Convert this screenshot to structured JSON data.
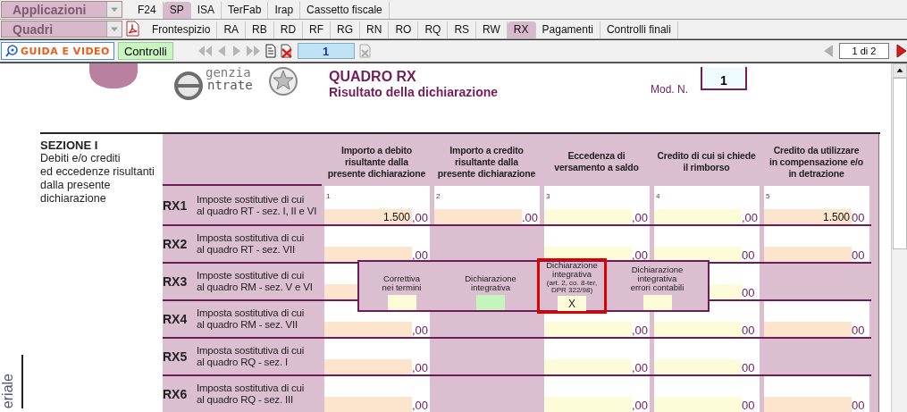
{
  "app_bar": {
    "dropdown": "Applicazioni",
    "tabs": [
      {
        "label": "F24",
        "selected": false
      },
      {
        "label": "SP",
        "selected": true
      },
      {
        "label": "ISA",
        "selected": false
      },
      {
        "label": "TerFab",
        "selected": false
      },
      {
        "label": "Irap",
        "selected": false
      },
      {
        "label": "Cassetto fiscale",
        "selected": false
      }
    ]
  },
  "quadri_bar": {
    "dropdown": "Quadri",
    "tabs": [
      {
        "label": "Frontespizio",
        "selected": false
      },
      {
        "label": "RA",
        "selected": false
      },
      {
        "label": "RB",
        "selected": false
      },
      {
        "label": "RD",
        "selected": false
      },
      {
        "label": "RF",
        "selected": false
      },
      {
        "label": "RG",
        "selected": false
      },
      {
        "label": "RN",
        "selected": false
      },
      {
        "label": "RO",
        "selected": false
      },
      {
        "label": "RQ",
        "selected": false
      },
      {
        "label": "RS",
        "selected": false
      },
      {
        "label": "RW",
        "selected": false
      },
      {
        "label": "RX",
        "selected": true
      },
      {
        "label": "Pagamenti",
        "selected": false
      },
      {
        "label": "Controlli finali",
        "selected": false
      }
    ]
  },
  "toolbar": {
    "guide_button": "GUIDA E VIDEO",
    "controls_button": "Controlli",
    "page_field": "1",
    "page_count": "1 di 2"
  },
  "header": {
    "logo_line_1": "genzia",
    "logo_line_2": "ntrate",
    "title": "QUADRO RX",
    "subtitle": "Risultato della dichiarazione",
    "model_label": "Mod. N.",
    "model_number": "1"
  },
  "section": {
    "title": "SEZIONE I",
    "description": "Debiti e/o crediti\ned eccedenze risultanti\ndalla presente\ndichiarazione",
    "columns": [
      "Importo a debito\nrisultante dalla\npresente dichiarazione",
      "Importo a credito\nrisultante dalla\npresente dichiarazione",
      "Eccedenza di\nversamento a saldo",
      "Credito di cui si chiede\nil rimborso",
      "Credito da utilizzare\nin compensazione e/o\nin detrazione"
    ],
    "rows": [
      {
        "code": "RX1",
        "description": "Imposte  sostitutive di cui\nal quadro RT - sez. I, II e VI",
        "cells": [
          {
            "number": "1",
            "value": "1.500",
            "suffix": ",00",
            "color": "#fde4cc"
          },
          {
            "number": "2",
            "suffix": ".00",
            "color": "#fde4cc"
          },
          {
            "number": "3",
            "suffix": ",00",
            "color": "#fdfcd8"
          },
          {
            "number": "4",
            "suffix": ",00",
            "color": "#fdfcd8"
          },
          {
            "number": "5",
            "value": "1.500",
            "suffix": "00",
            "color": "#fde4cc"
          }
        ]
      },
      {
        "code": "RX2",
        "description": "Imposta sostitutiva di cui\nal quadro RT - sez. VII",
        "cells": [
          {
            "suffix": ",00",
            "color": "#fde4cc"
          },
          null,
          {
            "suffix": ",00",
            "color": "#fdfcd8"
          },
          {
            "suffix": "00",
            "color": "#fdfcd8"
          },
          {
            "suffix": "00",
            "color": "#fde4cc"
          }
        ]
      },
      {
        "code": "RX3",
        "description": "Imposte sostitutive di cui\nal quadro RM - sez. V e VI",
        "cells": [
          {
            "color": "#fde4cc"
          },
          null,
          null,
          {
            "suffix": "00",
            "color": "#fdfcd8"
          },
          null
        ]
      },
      {
        "code": "RX4",
        "description": "Imposta sostitutiva di cui\nal quadro RM - sez. VII",
        "cells": [
          {
            "suffix": ",00",
            "color": "#fde4cc"
          },
          null,
          {
            "suffix": ",00",
            "color": "#fdfcd8"
          },
          {
            "suffix": "00",
            "color": "#fdfcd8"
          },
          {
            "suffix": "00",
            "color": "#fde4cc"
          }
        ]
      },
      {
        "code": "RX5",
        "description": "Imposta sostitutiva di cui\nal quadro RQ - sez. I",
        "cells": [
          {
            "suffix": ",00",
            "color": "#fde4cc"
          },
          null,
          {
            "suffix": ",00",
            "color": "#fdfcd8"
          },
          {
            "suffix": "00",
            "color": "#fdfcd8"
          },
          null
        ]
      },
      {
        "code": "RX6",
        "description": "Imposta sostitutiva di cui\nal quadro RQ - sez. III",
        "cells": [
          {
            "suffix": ",00",
            "color": "#fde4cc"
          },
          null,
          {
            "suffix": ",00",
            "color": "#fdfcd8"
          },
          {
            "suffix": "00",
            "color": "#fdfcd8"
          },
          {
            "suffix": "00",
            "color": "#fde4cc"
          }
        ]
      }
    ]
  },
  "popup": {
    "options": [
      {
        "label": "Correttiva\nnei termini",
        "color": "#fdfcd8",
        "highlighted": false
      },
      {
        "label": "Dichiarazione\nintegrativa",
        "color": "#c3f5bd",
        "highlighted": false
      },
      {
        "label": "Dichiarazione\nintegrativa",
        "note": "(art. 2, co. 8-ter,\nDPR 322/98)",
        "value": "X",
        "color": "#fdfcd8",
        "highlighted": true
      },
      {
        "label": "Dichiarazione\nintegrativa\nerrori contabili",
        "color": "#fdfcd8",
        "highlighted": false
      }
    ]
  },
  "side_text": "eriale"
}
